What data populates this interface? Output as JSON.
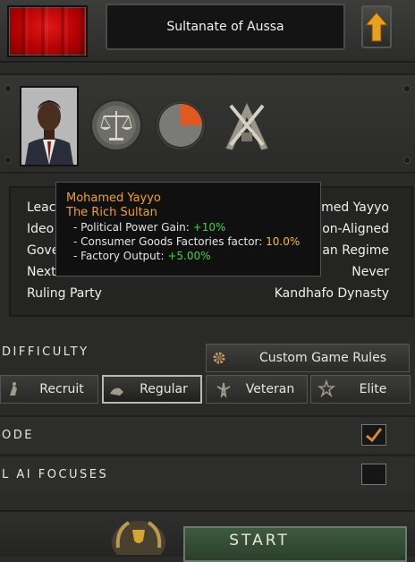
{
  "country": {
    "name": "Sultanate of Aussa"
  },
  "leader_rows": [
    {
      "label": "Leac",
      "value": "med Yayyo"
    },
    {
      "label": "Ideo",
      "value": "on-Aligned"
    },
    {
      "label": "Gove",
      "value": "an Regime"
    },
    {
      "label": "Next",
      "value": "Never"
    },
    {
      "label": "Ruling Party",
      "value": "Kandhafo Dynasty"
    }
  ],
  "tooltip": {
    "name": "Mohamed Yayyo",
    "trait": "The Rich Sultan",
    "effects": [
      {
        "label": "- Political Power Gain: ",
        "value": "+10%",
        "color": "#3fd13f"
      },
      {
        "label": "- Consumer Goods Factories factor: ",
        "value": "10.0%",
        "color": "#f0c020"
      },
      {
        "label": "- Factory Output: ",
        "value": "+5.00%",
        "color": "#3fd13f"
      }
    ]
  },
  "difficulty": {
    "title": "Difficulty",
    "custom_rules_label": "Custom Game Rules",
    "options": [
      {
        "label": "Recruit",
        "icon": "recruit-icon",
        "selected": false
      },
      {
        "label": "Regular",
        "icon": "regular-icon",
        "selected": true
      },
      {
        "label": "Veteran",
        "icon": "veteran-icon",
        "selected": false
      },
      {
        "label": "Elite",
        "icon": "elite-icon",
        "selected": false
      }
    ]
  },
  "toggles": [
    {
      "label": "ODE",
      "checked": true
    },
    {
      "label": "L AI Focuses",
      "checked": false
    }
  ],
  "start": {
    "label": "START"
  }
}
